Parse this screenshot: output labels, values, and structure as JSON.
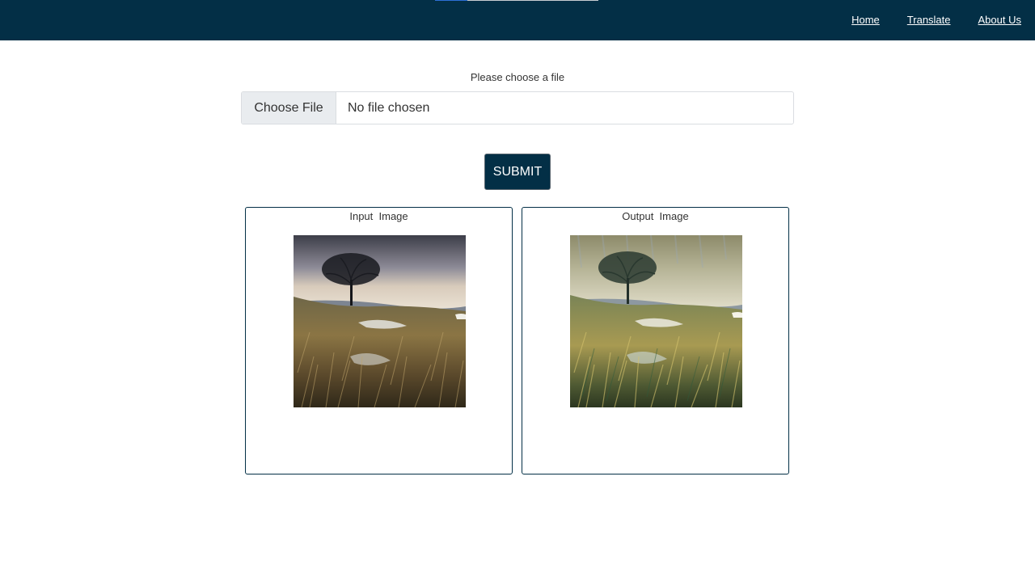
{
  "navbar": {
    "progress_fraction": 0.2,
    "links": [
      {
        "label": "Home"
      },
      {
        "label": "Translate"
      },
      {
        "label": "About Us"
      }
    ]
  },
  "upload": {
    "label": "Please choose a file",
    "choose_button": "Choose File",
    "status": "No file chosen"
  },
  "submit": {
    "label": "SUBMIT"
  },
  "panels": {
    "input": {
      "title": "Input  Image",
      "image": "landscape-tree-photo"
    },
    "output": {
      "title": "Output  Image",
      "image": "stylized-landscape-tree"
    }
  },
  "colors": {
    "navbar_bg": "#032f46",
    "submit_bg": "#032f46",
    "panel_border": "#032f46"
  }
}
